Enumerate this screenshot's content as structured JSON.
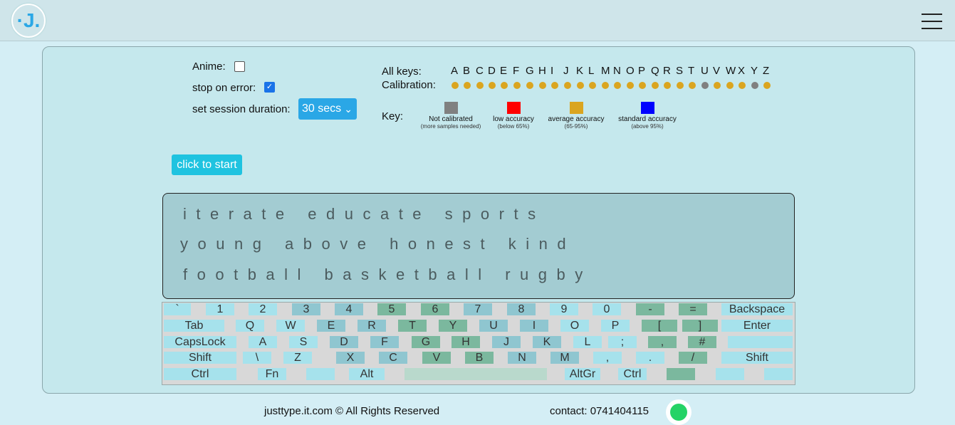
{
  "header": {
    "logo_text": "·J.",
    "menu_icon": "hamburger-menu-icon"
  },
  "settings": {
    "anime_label": "Anime:",
    "anime_checked": false,
    "stop_label": "stop on error:",
    "stop_checked": true,
    "duration_label": "set session duration:",
    "duration_value": "30 secs",
    "start_label": "click to start"
  },
  "calibration": {
    "allkeys_label": "All keys:",
    "calibration_label": "Calibration:",
    "letters": [
      "A",
      "B",
      "C",
      "D",
      "E",
      "F",
      "G",
      "H",
      "I",
      "J",
      "K",
      "L",
      "M",
      "N",
      "O",
      "P",
      "Q",
      "R",
      "S",
      "T",
      "U",
      "V",
      "W",
      "X",
      "Y",
      "Z"
    ],
    "levels": [
      "average",
      "average",
      "average",
      "average",
      "average",
      "average",
      "average",
      "average",
      "average",
      "average",
      "average",
      "average",
      "average",
      "average",
      "average",
      "average",
      "average",
      "average",
      "average",
      "average",
      "not",
      "average",
      "average",
      "average",
      "not",
      "average"
    ],
    "colors": {
      "not": "#808080",
      "low": "#ff0000",
      "average": "#daa520",
      "standard": "#0000ff"
    }
  },
  "legend": {
    "title": "Key:",
    "items": [
      {
        "label": "Not calibrated",
        "sub": "(more samples needed)",
        "color": "#808080"
      },
      {
        "label": "low accuracy",
        "sub": "(below 65%)",
        "color": "#ff0000"
      },
      {
        "label": "average accuracy",
        "sub": "(65-95%)",
        "color": "#daa520"
      },
      {
        "label": "standard accuracy",
        "sub": "(above 95%)",
        "color": "#0000ff"
      }
    ]
  },
  "text": {
    "lines": [
      "iterate educate sports",
      "young above honest kind",
      "football basketball rugby"
    ]
  },
  "keyboard": {
    "rows": [
      [
        "`",
        "1",
        "2",
        "3",
        "4",
        "5",
        "6",
        "7",
        "8",
        "9",
        "0",
        "-",
        "=",
        "Backspace"
      ],
      [
        "Tab",
        "Q",
        "W",
        "E",
        "R",
        "T",
        "Y",
        "U",
        "I",
        "O",
        "P",
        "[",
        "]",
        "Enter"
      ],
      [
        "CapsLock",
        "A",
        "S",
        "D",
        "F",
        "G",
        "H",
        "J",
        "K",
        "L",
        ";",
        ",",
        "#",
        ""
      ],
      [
        "Shift",
        "\\",
        "Z",
        "X",
        "C",
        "V",
        "B",
        "N",
        "M",
        ",",
        ".",
        "/",
        "Shift"
      ],
      [
        "Ctrl",
        "Fn",
        "",
        "Alt",
        "",
        "AltGr",
        "Ctrl",
        "",
        "",
        ""
      ]
    ]
  },
  "footer": {
    "copyright": "justtype.it.com © All Rights Reserved",
    "contact": "contact: 0741404115",
    "whatsapp_icon": "whatsapp-icon"
  }
}
